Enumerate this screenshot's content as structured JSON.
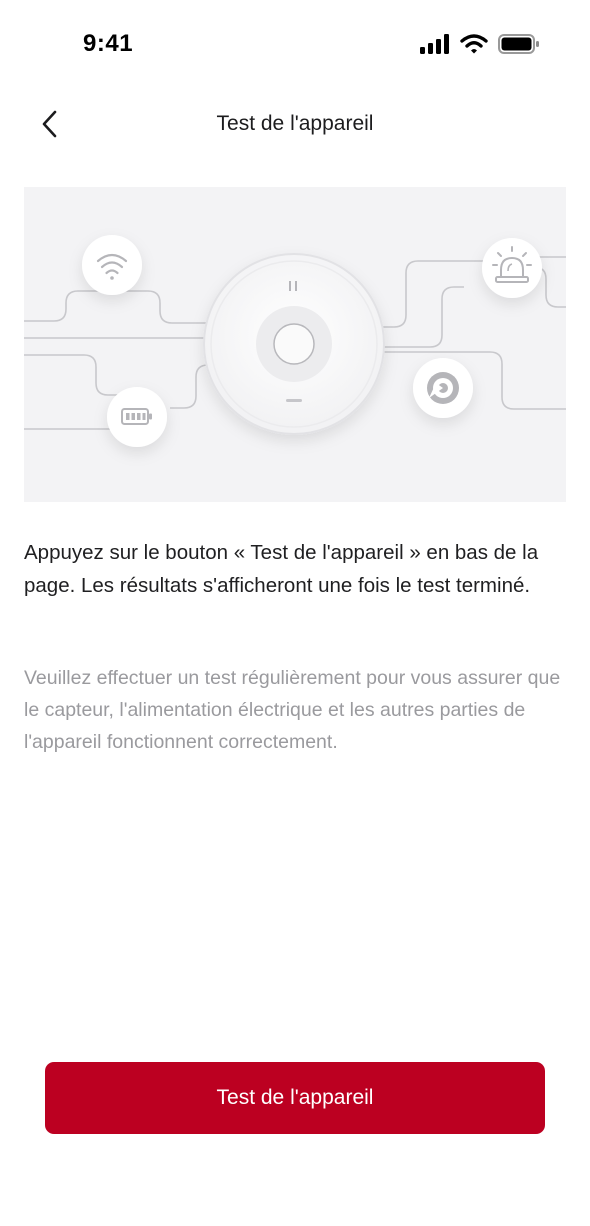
{
  "status_bar": {
    "time": "9:41",
    "icons": [
      "cellular-signal-icon",
      "wifi-icon",
      "battery-icon"
    ]
  },
  "nav": {
    "title": "Test de l'appareil",
    "back_icon": "chevron-left-icon"
  },
  "illustration": {
    "icons": [
      "wifi-icon",
      "alarm-siren-icon",
      "battery-icon",
      "sensor-icon"
    ]
  },
  "content": {
    "primary": "Appuyez sur le bouton « Test de l'appareil » en bas de la page. Les résultats s'afficheront une fois le test terminé.",
    "secondary": "Veuillez effectuer un test régulièrement pour vous assurer que le capteur, l'alimentation électrique et les autres parties de l'appareil fonctionnent correctement."
  },
  "button": {
    "label": "Test de l'appareil"
  },
  "colors": {
    "accent": "#bc0021",
    "primary_text": "#1f1f21",
    "secondary_text": "#9a9a9e",
    "illustration_bg": "#f3f3f5"
  }
}
